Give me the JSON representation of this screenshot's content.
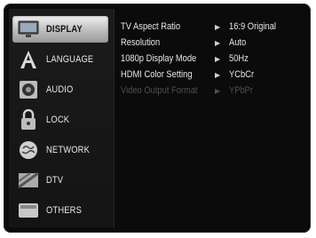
{
  "menu": {
    "categories": [
      {
        "label": "DISPLAY",
        "icon": "display-icon",
        "selected": true
      },
      {
        "label": "LANGUAGE",
        "icon": "language-icon",
        "selected": false
      },
      {
        "label": "AUDIO",
        "icon": "audio-icon",
        "selected": false
      },
      {
        "label": "LOCK",
        "icon": "lock-icon",
        "selected": false
      },
      {
        "label": "NETWORK",
        "icon": "network-icon",
        "selected": false
      },
      {
        "label": "DTV",
        "icon": "dtv-icon",
        "selected": false
      },
      {
        "label": "OTHERS",
        "icon": "others-icon",
        "selected": false
      }
    ]
  },
  "settings": {
    "rows": [
      {
        "name": "TV Aspect Ratio",
        "value": "16:9 Original",
        "enabled": true
      },
      {
        "name": "Resolution",
        "value": "Auto",
        "enabled": true
      },
      {
        "name": "1080p Display Mode",
        "value": "50Hz",
        "enabled": true
      },
      {
        "name": "HDMI Color Setting",
        "value": "YCbCr",
        "enabled": true
      },
      {
        "name": "Video Output Format",
        "value": "YPbPr",
        "enabled": false
      }
    ],
    "arrow_glyph": "▶"
  },
  "colors": {
    "background": "#0b0b0b",
    "selected_highlight": "#cfcfcf",
    "text": "#e6e6e6",
    "disabled_text": "#4e4e4e"
  }
}
